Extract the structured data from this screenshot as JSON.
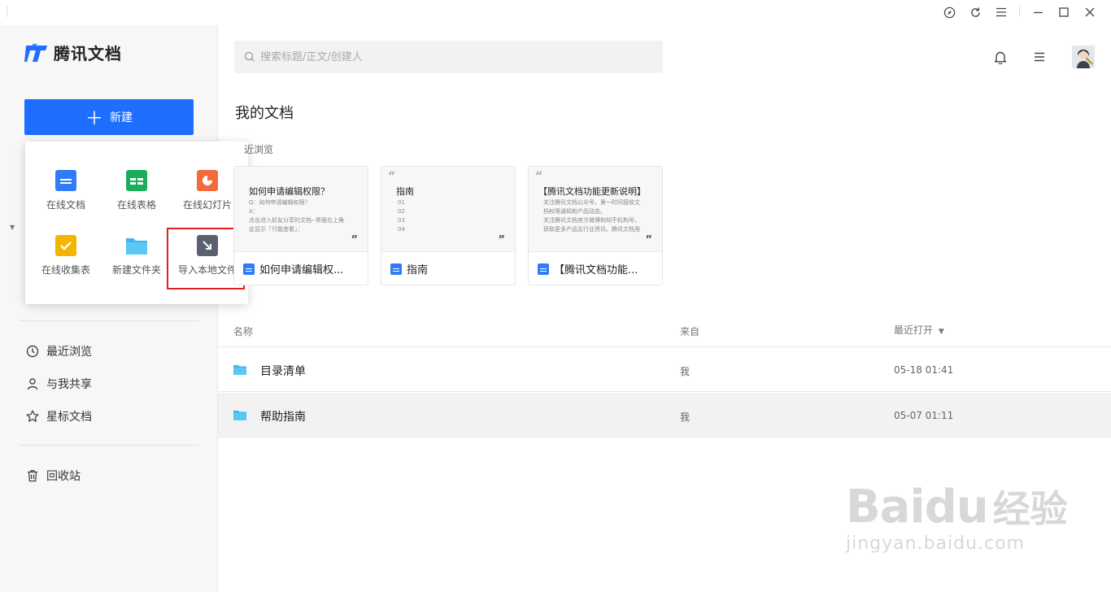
{
  "app": {
    "brand": "腾讯文档"
  },
  "sidebar": {
    "new_label": "新建",
    "nav": [
      {
        "label": "最近浏览",
        "icon": "clock-icon"
      },
      {
        "label": "与我共享",
        "icon": "user-icon"
      },
      {
        "label": "星标文档",
        "icon": "star-icon"
      },
      {
        "label": "回收站",
        "icon": "trash-icon"
      }
    ]
  },
  "popup": {
    "items": [
      {
        "label": "在线文档",
        "icon": "online-doc-icon",
        "color": "#2f7cf6"
      },
      {
        "label": "在线表格",
        "icon": "online-sheet-icon",
        "color": "#1aae5c"
      },
      {
        "label": "在线幻灯片",
        "icon": "online-slide-icon",
        "color": "#f26b3a"
      },
      {
        "label": "在线收集表",
        "icon": "online-form-icon",
        "color": "#f5b400"
      },
      {
        "label": "新建文件夹",
        "icon": "new-folder-icon",
        "color": "#3cb7f0"
      },
      {
        "label": "导入本地文件",
        "icon": "import-file-icon",
        "color": "#5a6272"
      }
    ]
  },
  "search": {
    "placeholder": "搜索标题/正文/创建人"
  },
  "main": {
    "title": "我的文档",
    "recent_label": "近浏览",
    "cards": [
      {
        "preview_title": "如何申请编辑权限？",
        "preview_lines": [
          "Q：如何申请编辑权限？",
          "A：",
          "点击进入好友分享的文档--界面右上角",
          "会显示「只能查看」："
        ],
        "name": "如何申请编辑权..."
      },
      {
        "preview_title": "指南",
        "preview_lines": [
          "01",
          "02",
          "03",
          "04"
        ],
        "name": "指南"
      },
      {
        "preview_title": "【腾讯文档功能更新说明】",
        "preview_lines": [
          "关注腾讯文档公众号，第一时间接收文",
          "档权限通知和产品动态。",
          "关注腾讯文档官方微博和知乎机构号，",
          "获取更多产品及行业资讯。腾讯文档用"
        ],
        "name": "【腾讯文档功能..."
      }
    ]
  },
  "table": {
    "headers": {
      "name": "名称",
      "from": "来自",
      "opened": "最近打开"
    },
    "rows": [
      {
        "name": "目录清单",
        "from": "我",
        "opened": "05-18 01:41"
      },
      {
        "name": "帮助指南",
        "from": "我",
        "opened": "05-07 01:11"
      }
    ]
  },
  "colors": {
    "accent": "#1e6fff",
    "highlight": "#e02020",
    "folder": "#3cb7f0"
  },
  "watermark": {
    "brand": "Baidu",
    "cn": "经验",
    "url": "jingyan.baidu.com"
  }
}
